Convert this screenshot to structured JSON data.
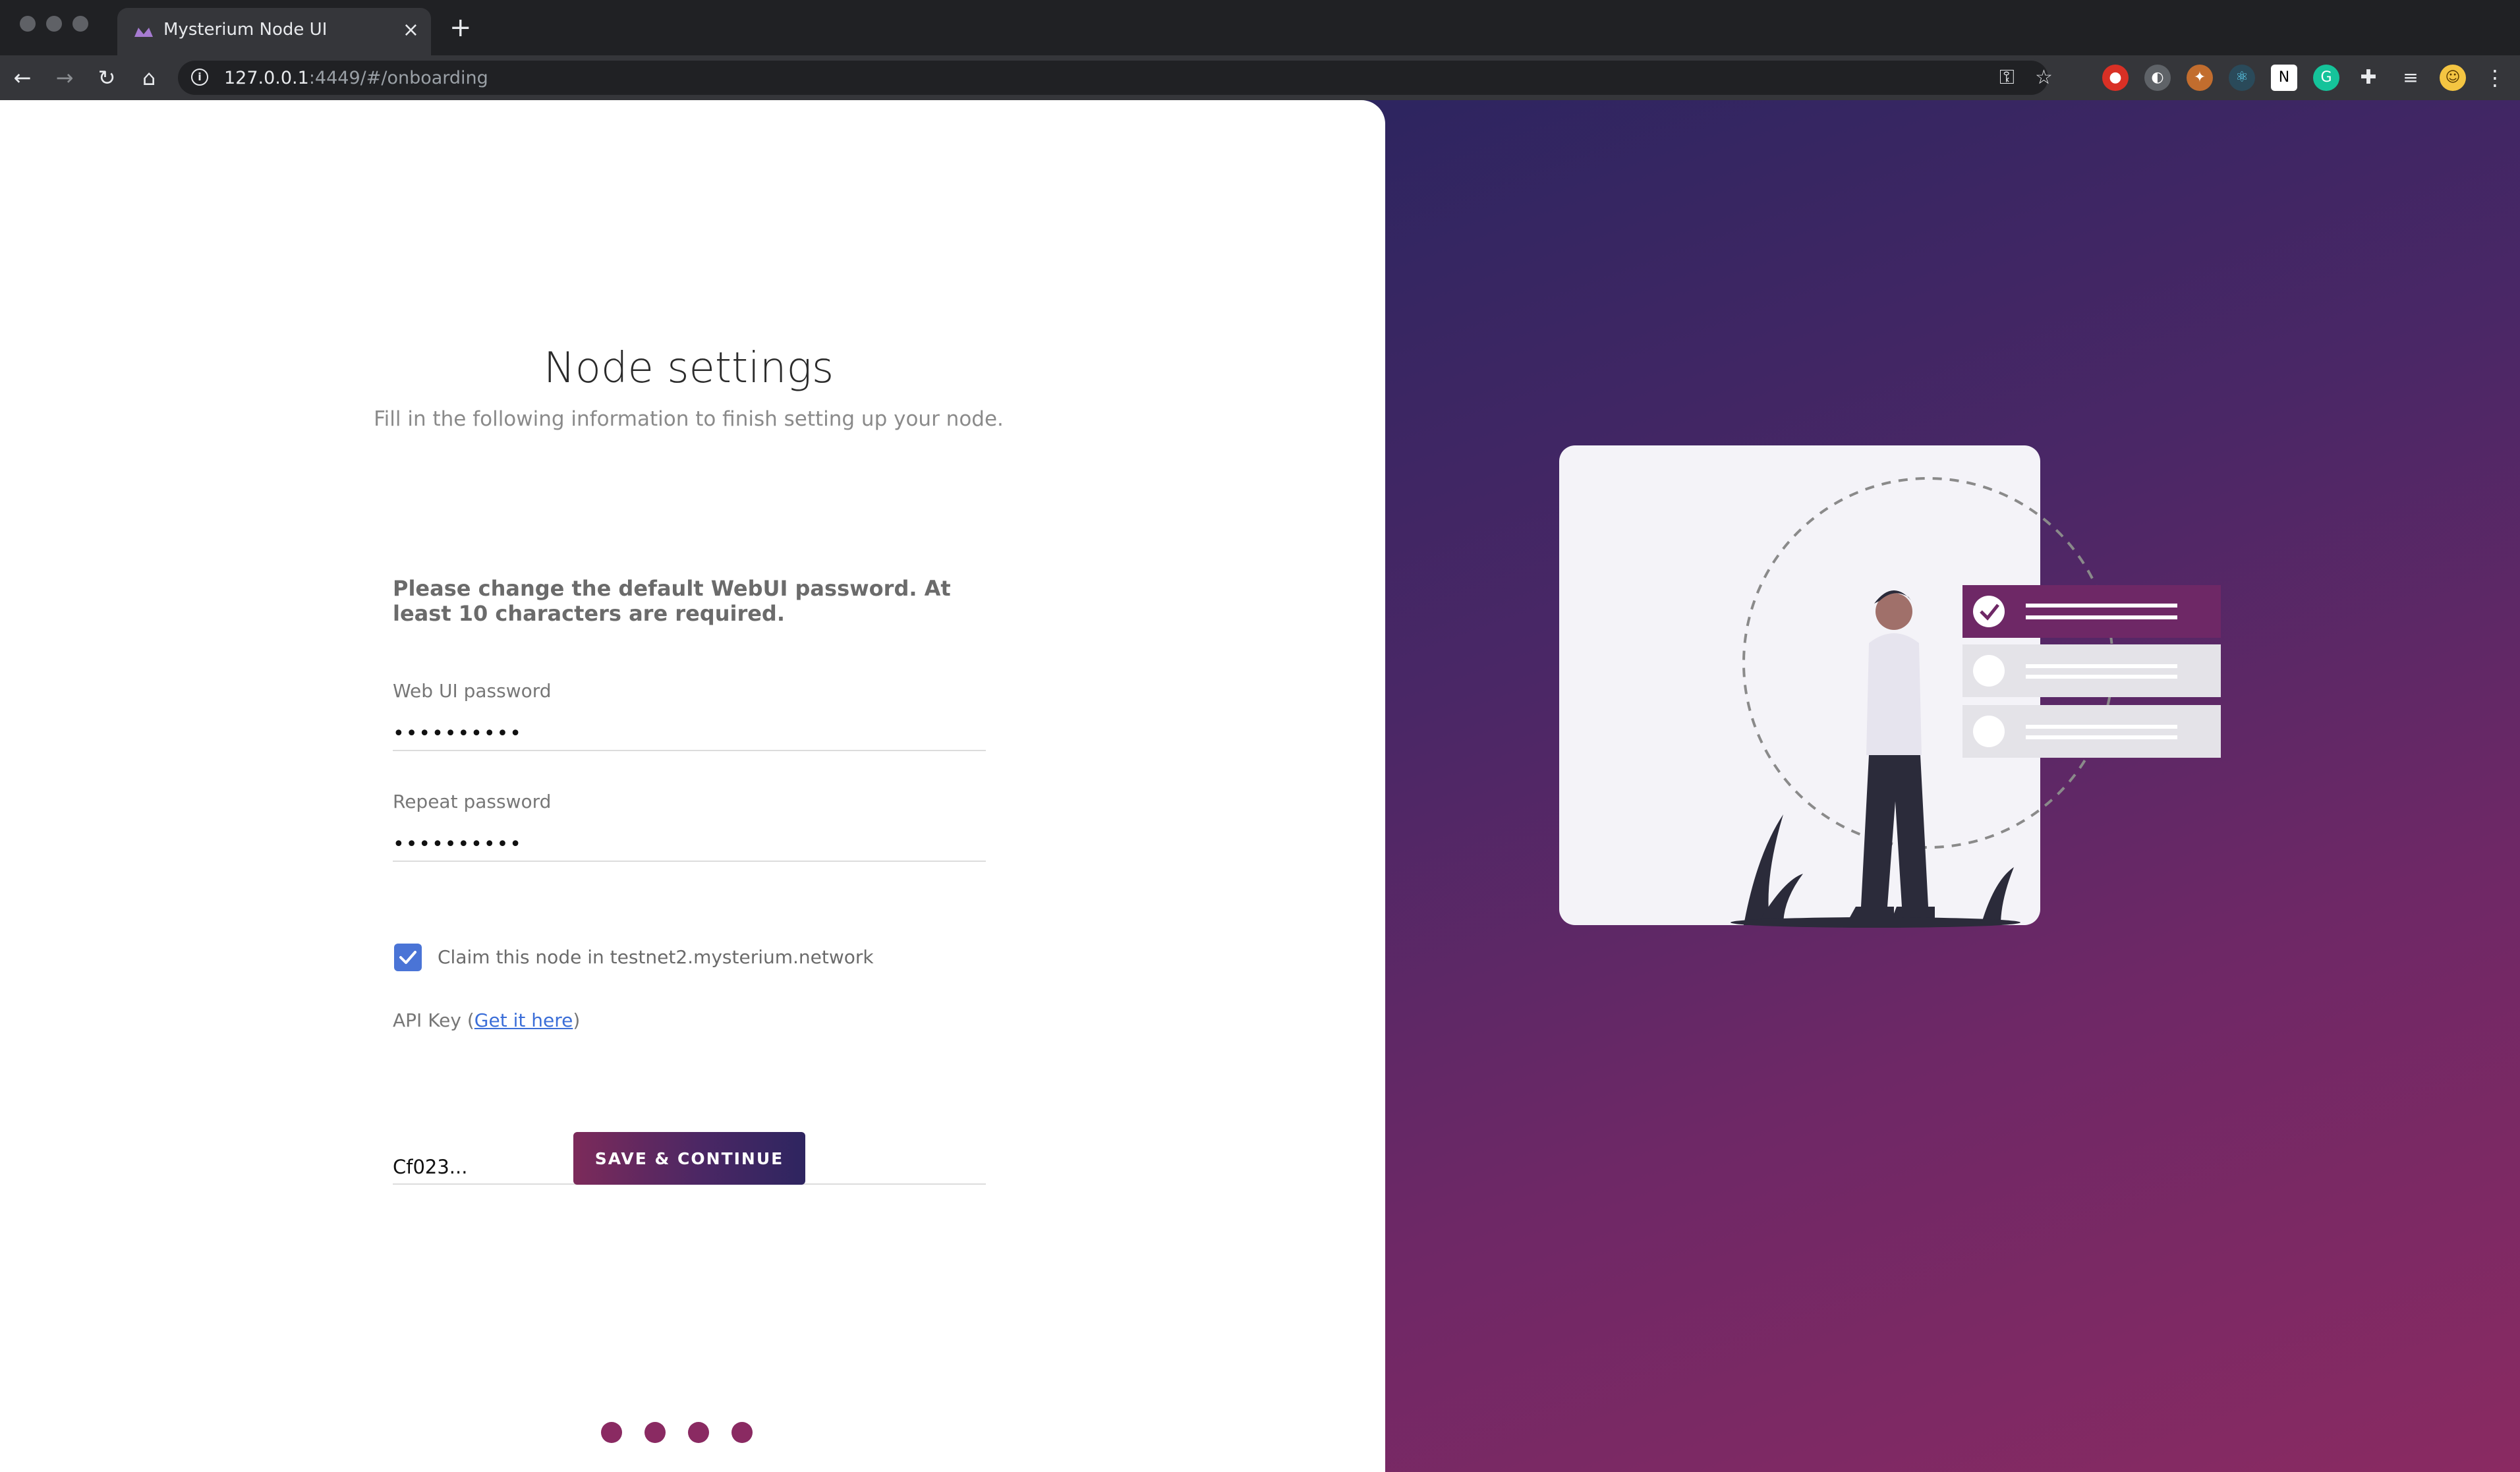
{
  "browser": {
    "tab_title": "Mysterium Node UI",
    "tab_close": "×",
    "new_tab": "+",
    "url_host": "127.0.0.1",
    "url_rest": ":4449/#/onboarding",
    "nav": {
      "back": "←",
      "forward": "→",
      "reload": "↻",
      "home": "⌂"
    },
    "toolbar_icons": {
      "key": "⚿",
      "star": "☆",
      "menu": "⋮"
    }
  },
  "onboarding": {
    "title": "Node settings",
    "subtitle": "Fill in the following information to finish setting up your node.",
    "notice": "Please change the default WebUI password. At least 10 characters are required.",
    "password_label": "Web UI password",
    "password_value": "••••••••••",
    "repeat_label": "Repeat password",
    "repeat_value": "••••••••••",
    "claim_checked": true,
    "claim_label": "Claim this node in testnet2.mysterium.network",
    "api_label_prefix": "API Key (",
    "api_link": "Get it here",
    "api_label_suffix": ")",
    "api_value": "Cf023...",
    "submit_label": "SAVE & CONTINUE",
    "steps_total": 4
  },
  "colors": {
    "accent": "#8a2a62",
    "checkbox": "#4a74d6",
    "gradient_start": "#2d2560",
    "gradient_end": "#8a2a62"
  }
}
